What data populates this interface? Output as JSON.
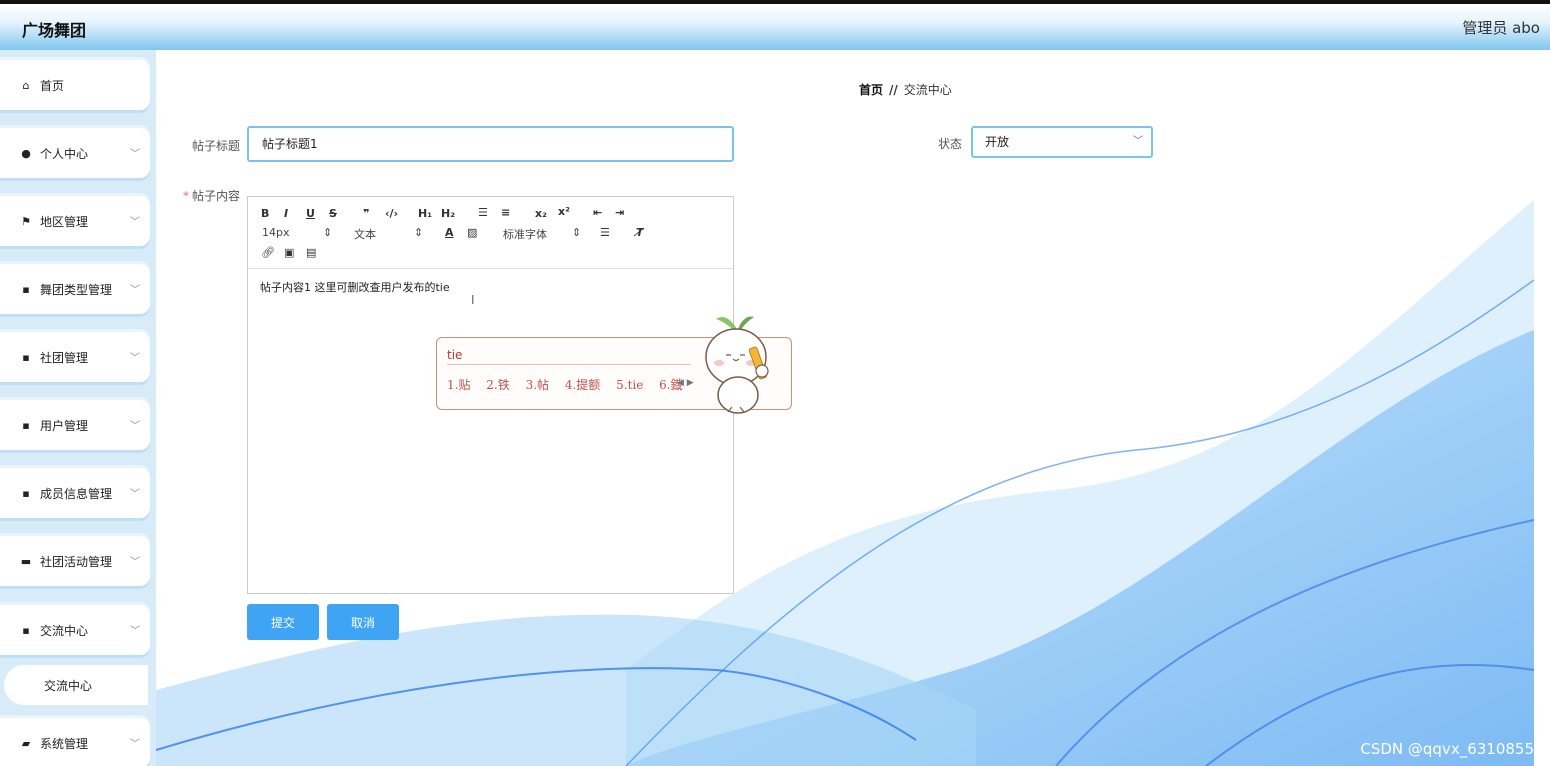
{
  "header": {
    "brand": "广场舞团",
    "user": "管理员 abo"
  },
  "sidebar": {
    "items": [
      {
        "label": "首页",
        "icon": "home-icon",
        "glyph": "⌂"
      },
      {
        "label": "个人中心",
        "icon": "user-icon",
        "glyph": "●"
      },
      {
        "label": "地区管理",
        "icon": "flag-icon",
        "glyph": "⚑"
      },
      {
        "label": "舞团类型管理",
        "icon": "grid-icon",
        "glyph": "▪"
      },
      {
        "label": "社团管理",
        "icon": "grid-icon",
        "glyph": "▪"
      },
      {
        "label": "用户管理",
        "icon": "grid-icon",
        "glyph": "▪"
      },
      {
        "label": "成员信息管理",
        "icon": "grid-icon",
        "glyph": "▪"
      },
      {
        "label": "社团活动管理",
        "icon": "monitor-icon",
        "glyph": "▬"
      },
      {
        "label": "交流中心",
        "icon": "grid-icon",
        "glyph": "▪"
      },
      {
        "label": "系统管理",
        "icon": "briefcase-icon",
        "glyph": "▰"
      }
    ],
    "sub_item": "交流中心"
  },
  "breadcrumb": {
    "home": "首页",
    "sep": "//",
    "current": "交流中心"
  },
  "form": {
    "title_label": "帖子标题",
    "title_value": "帖子标题1",
    "status_label": "状态",
    "status_value": "开放",
    "content_label": "帖子内容",
    "required_mark": "*",
    "content_value": "帖子内容1  这里可删改查用户发布的tie"
  },
  "editor": {
    "font_size": "14px",
    "header_select": "文本",
    "font_family": "标准字体"
  },
  "ime": {
    "input": "tie",
    "candidates": [
      "1.贴",
      "2.铁",
      "3.帖",
      "4.提额",
      "5.tie",
      "6.鐡"
    ]
  },
  "buttons": {
    "submit": "提交",
    "cancel": "取消"
  },
  "watermark": "CSDN @qqvx_6310855"
}
